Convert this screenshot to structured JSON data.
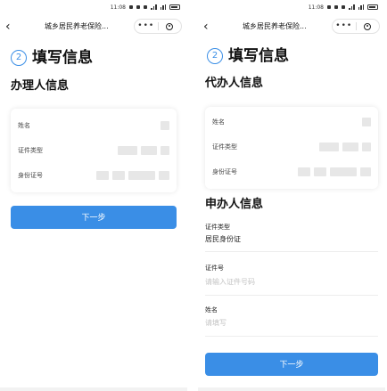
{
  "status_bar": {
    "time": "11:08"
  },
  "navbar": {
    "back_icon": "chevron-left-icon",
    "title": "城乡居民养老保险...",
    "more": "•••",
    "close_icon": "target-circle-icon"
  },
  "page": {
    "step_number": "2",
    "step_title": "填写信息"
  },
  "left": {
    "section_title": "办理人信息",
    "fields": [
      {
        "label": "姓名"
      },
      {
        "label": "证件类型"
      },
      {
        "label": "身份证号"
      }
    ],
    "next_button": "下一步"
  },
  "right": {
    "agent_section_title": "代办人信息",
    "agent_fields": [
      {
        "label": "姓名"
      },
      {
        "label": "证件类型"
      },
      {
        "label": "身份证号"
      }
    ],
    "applicant_section_title": "申办人信息",
    "doc_type": {
      "label": "证件类型",
      "value": "居民身份证"
    },
    "doc_number": {
      "label": "证件号",
      "placeholder": "请输入证件号码"
    },
    "name": {
      "label": "姓名",
      "placeholder": "请填写"
    },
    "next_button": "下一步"
  },
  "colors": {
    "primary": "#3a8ee6",
    "masked": "#e7e7e7",
    "text": "#222222"
  }
}
